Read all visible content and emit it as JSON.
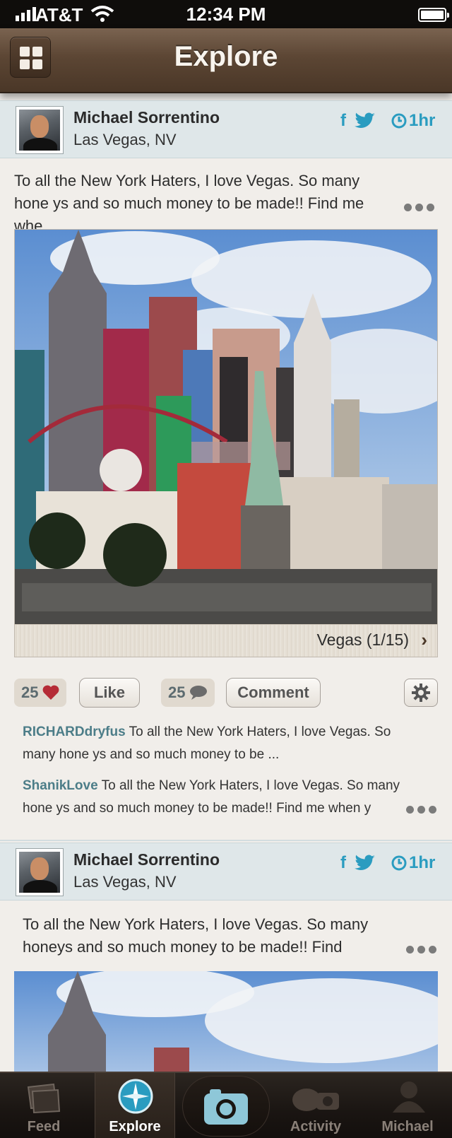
{
  "status_bar": {
    "carrier": "AT&T",
    "time": "12:34 PM"
  },
  "nav": {
    "title": "Explore",
    "grid_icon": "grid-icon"
  },
  "posts": [
    {
      "author": "Michael Sorrentino",
      "location": "Las Vegas, NV",
      "share_fb": "f",
      "time": "1hr",
      "text": "To all the New York Haters, I love Vegas. So many hone ys and so much money to be made!! Find me whe",
      "photo_caption": "Vegas (1/15)",
      "likes": "25",
      "comments_count": "25",
      "like_label": "Like",
      "comment_label": "Comment",
      "comments": [
        {
          "user": "RICHARDdryfus",
          "text": " To all the New York Haters, I love Vegas. So many hone ys and so much money to be ..."
        },
        {
          "user": "ShanikLove",
          "text": " To all the New York Haters, I love Vegas. So many hone ys and so much money to be made!! Find me when y"
        }
      ]
    },
    {
      "author": "Michael Sorrentino",
      "location": "Las Vegas, NV",
      "share_fb": "f",
      "time": "1hr",
      "text": "To all the New York Haters, I love Vegas. So many honeys and so much money to be made!! Find"
    }
  ],
  "tabs": [
    {
      "label": "Feed",
      "icon": "feed-icon"
    },
    {
      "label": "Explore",
      "icon": "compass-icon"
    },
    {
      "label": "",
      "icon": "camera-icon"
    },
    {
      "label": "Activity",
      "icon": "activity-icon"
    },
    {
      "label": "Michael",
      "icon": "profile-icon"
    }
  ],
  "colors": {
    "accent": "#2a9cc0",
    "nav_brown": "#5c4634",
    "tab_bg": "#1a1512"
  }
}
